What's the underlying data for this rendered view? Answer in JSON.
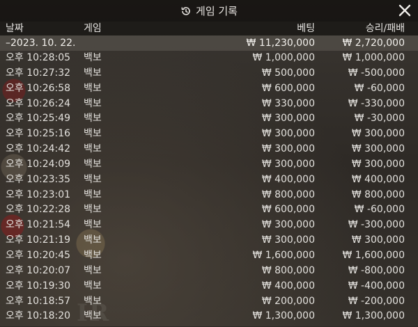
{
  "title": "게임 기록",
  "icons": {
    "history": "history-icon",
    "close": "close-icon"
  },
  "columns": {
    "date": "날짜",
    "game": "게임",
    "bet": "베팅",
    "winloss": "승리/패배"
  },
  "summary": {
    "date": "–2023. 10. 22.",
    "bet": "₩ 11,230,000",
    "winloss": "₩ 2,720,000"
  },
  "rows": [
    {
      "time": "오후 10:28:05",
      "game": "백보",
      "bet": "₩ 1,000,000",
      "winloss": "₩ 1,000,000"
    },
    {
      "time": "오후 10:27:32",
      "game": "백보",
      "bet": "₩ 500,000",
      "winloss": "₩ -500,000"
    },
    {
      "time": "오후 10:26:58",
      "game": "백보",
      "bet": "₩ 600,000",
      "winloss": "₩ -60,000"
    },
    {
      "time": "오후 10:26:24",
      "game": "백보",
      "bet": "₩ 330,000",
      "winloss": "₩ -330,000"
    },
    {
      "time": "오후 10:25:49",
      "game": "백보",
      "bet": "₩ 300,000",
      "winloss": "₩ -30,000"
    },
    {
      "time": "오후 10:25:16",
      "game": "백보",
      "bet": "₩ 300,000",
      "winloss": "₩ 300,000"
    },
    {
      "time": "오후 10:24:42",
      "game": "백보",
      "bet": "₩ 300,000",
      "winloss": "₩ 300,000"
    },
    {
      "time": "오후 10:24:09",
      "game": "백보",
      "bet": "₩ 300,000",
      "winloss": "₩ 300,000"
    },
    {
      "time": "오후 10:23:35",
      "game": "백보",
      "bet": "₩ 400,000",
      "winloss": "₩ 400,000"
    },
    {
      "time": "오후 10:23:01",
      "game": "백보",
      "bet": "₩ 800,000",
      "winloss": "₩ 800,000"
    },
    {
      "time": "오후 10:22:28",
      "game": "백보",
      "bet": "₩ 600,000",
      "winloss": "₩ -60,000"
    },
    {
      "time": "오후 10:21:54",
      "game": "백보",
      "bet": "₩ 300,000",
      "winloss": "₩ -300,000"
    },
    {
      "time": "오후 10:21:19",
      "game": "백보",
      "bet": "₩ 300,000",
      "winloss": "₩ 300,000"
    },
    {
      "time": "오후 10:20:45",
      "game": "백보",
      "bet": "₩ 1,600,000",
      "winloss": "₩ 1,600,000"
    },
    {
      "time": "오후 10:20:07",
      "game": "백보",
      "bet": "₩ 800,000",
      "winloss": "₩ -800,000"
    },
    {
      "time": "오후 10:19:30",
      "game": "백보",
      "bet": "₩ 400,000",
      "winloss": "₩ -400,000"
    },
    {
      "time": "오후 10:18:57",
      "game": "백보",
      "bet": "₩ 200,000",
      "winloss": "₩ -200,000"
    },
    {
      "time": "오후 10:18:20",
      "game": "백보",
      "bet": "₩ 1,300,000",
      "winloss": "₩ 1,300,000"
    }
  ]
}
